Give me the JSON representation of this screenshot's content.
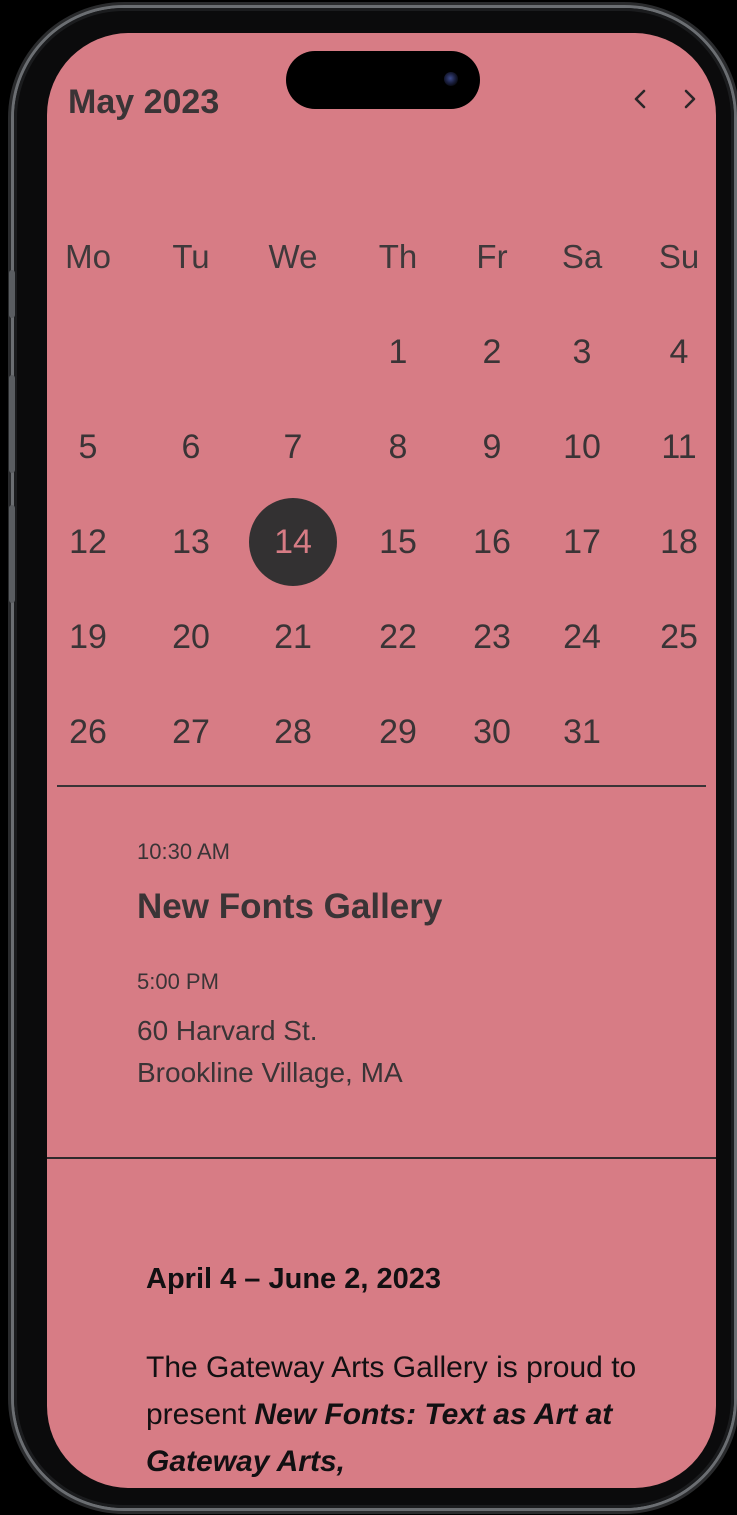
{
  "calendar": {
    "month_title": "May 2023",
    "nav": {
      "prev_glyph": "‹",
      "next_glyph": "›"
    },
    "weekdays": [
      "Mo",
      "Tu",
      "We",
      "Th",
      "Fr",
      "Sa",
      "Su"
    ],
    "first_weekday_index": 3,
    "days_in_month": 31,
    "selected_day": "14"
  },
  "event": {
    "start_time": "10:30 AM",
    "title": "New Fonts Gallery",
    "end_time": "5:00 PM",
    "address_line1": "60 Harvard St.",
    "address_line2": "Brookline Village, MA"
  },
  "exhibit": {
    "dates": "April 4 – June 2, 2023",
    "body_plain": "The Gateway Arts Gallery is proud to present ",
    "body_emphasis": "New Fonts: Text as Art at Gateway Arts,"
  },
  "colors": {
    "screen_background": "#d77c85",
    "text_dark": "#3a3436",
    "selected_circle": "#333132"
  }
}
